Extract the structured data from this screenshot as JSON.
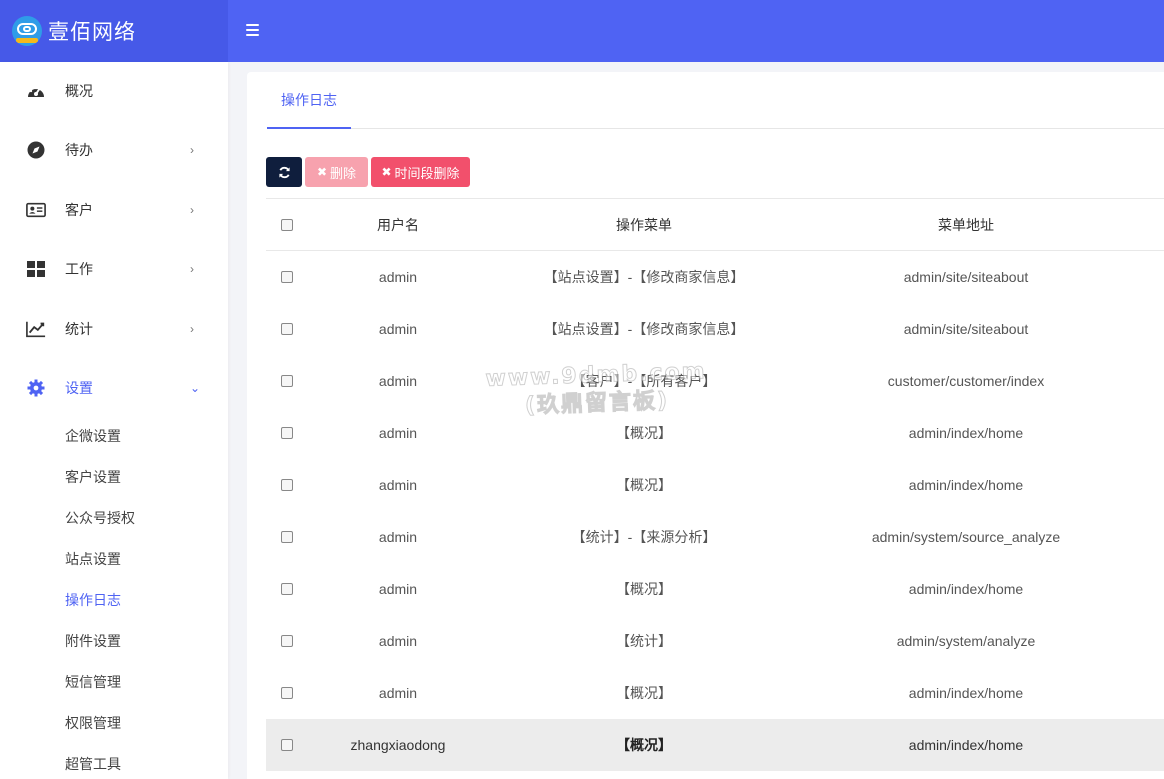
{
  "header": {
    "brand": "壹佰网络"
  },
  "sidebar": {
    "items": [
      {
        "label": "概况",
        "icon": "dashboard-icon"
      },
      {
        "label": "待办",
        "icon": "compass-icon",
        "chevron": "›"
      },
      {
        "label": "客户",
        "icon": "id-card-icon",
        "chevron": "›"
      },
      {
        "label": "工作",
        "icon": "grid-icon",
        "chevron": "›"
      },
      {
        "label": "统计",
        "icon": "line-chart-icon",
        "chevron": "›"
      },
      {
        "label": "设置",
        "icon": "gear-icon",
        "chevron": "⌄",
        "active": true
      }
    ],
    "sub_items": [
      "企微设置",
      "客户设置",
      "公众号授权",
      "站点设置",
      "操作日志",
      "附件设置",
      "短信管理",
      "权限管理",
      "超管工具"
    ],
    "active_sub": "操作日志"
  },
  "tabs": [
    {
      "label": "操作日志"
    }
  ],
  "toolbar": {
    "delete_label": "删除",
    "time_delete_label": "时间段删除"
  },
  "table": {
    "headers": {
      "user": "用户名",
      "menu": "操作菜单",
      "url": "菜单地址"
    },
    "rows": [
      {
        "user": "admin",
        "menu": "【站点设置】-【修改商家信息】",
        "url": "admin/site/siteabout"
      },
      {
        "user": "admin",
        "menu": "【站点设置】-【修改商家信息】",
        "url": "admin/site/siteabout"
      },
      {
        "user": "admin",
        "menu": "【客户】-【所有客户】",
        "url": "customer/customer/index"
      },
      {
        "user": "admin",
        "menu": "【概况】",
        "url": "admin/index/home"
      },
      {
        "user": "admin",
        "menu": "【概况】",
        "url": "admin/index/home"
      },
      {
        "user": "admin",
        "menu": "【统计】-【来源分析】",
        "url": "admin/system/source_analyze"
      },
      {
        "user": "admin",
        "menu": "【概况】",
        "url": "admin/index/home"
      },
      {
        "user": "admin",
        "menu": "【统计】",
        "url": "admin/system/analyze"
      },
      {
        "user": "admin",
        "menu": "【概况】",
        "url": "admin/index/home"
      },
      {
        "user": "zhangxiaodong",
        "menu": "【概况】",
        "url": "admin/index/home"
      }
    ]
  },
  "watermark": {
    "line1": "www.9dmb.com",
    "line2": "(玖鼎留言板)"
  },
  "colors": {
    "primary": "#4f63f3",
    "danger": "#f2506c",
    "danger_light": "#f7a2ae",
    "dark": "#0f1e3d"
  }
}
